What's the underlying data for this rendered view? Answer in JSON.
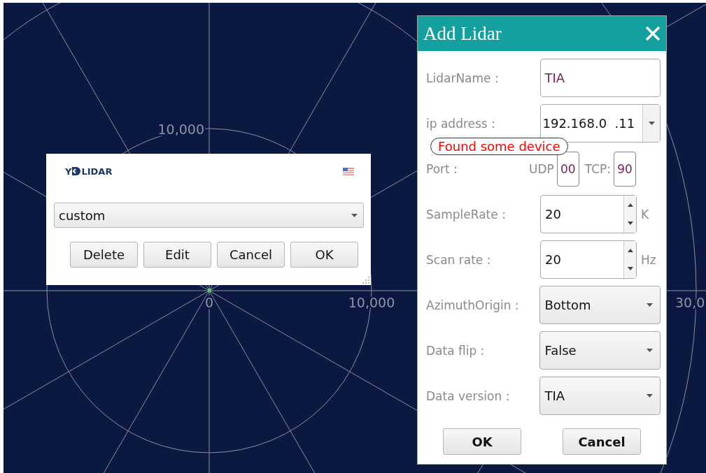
{
  "plot": {
    "tick_labels": [
      {
        "text": "10,000"
      },
      {
        "text": "0"
      },
      {
        "text": "10,000"
      },
      {
        "text": "30,0"
      }
    ]
  },
  "profile_dialog": {
    "logo": {
      "left": "Y",
      "right": "LIDAR"
    },
    "profile": "custom",
    "buttons": [
      "Delete",
      "Edit",
      "Cancel",
      "OK"
    ]
  },
  "add_lidar": {
    "title": "Add Lidar",
    "tooltip": "Found some device",
    "rows": [
      {
        "kind": "text",
        "label": "LidarName :",
        "value": "TIA"
      },
      {
        "kind": "combo",
        "label": "ip address :",
        "value": "192.168.0  .11"
      },
      {
        "kind": "port",
        "label": "Port :",
        "udp_label": "UDP",
        "udp_value": "00",
        "tcp_label": "TCP:",
        "tcp_value": "90"
      },
      {
        "kind": "spin",
        "label": "SampleRate :",
        "value": "20",
        "unit": "K"
      },
      {
        "kind": "spin",
        "label": "Scan rate :",
        "value": "20",
        "unit": "Hz"
      },
      {
        "kind": "select",
        "label": "AzimuthOrigin :",
        "value": "Bottom"
      },
      {
        "kind": "select",
        "label": "Data flip :",
        "value": "False"
      },
      {
        "kind": "select",
        "label": "Data version :",
        "value": "TIA"
      }
    ],
    "buttons": [
      "OK",
      "Cancel"
    ]
  }
}
